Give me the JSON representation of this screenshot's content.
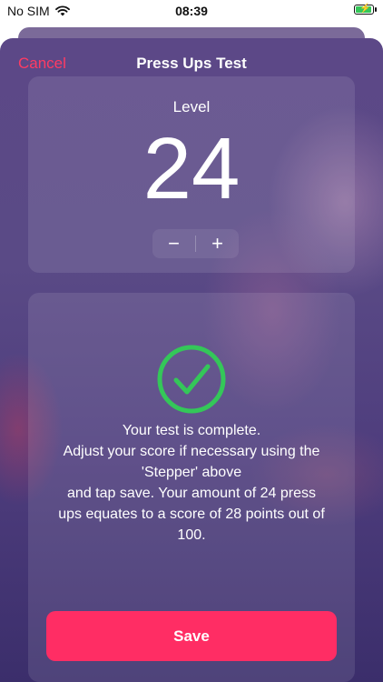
{
  "status_bar": {
    "carrier": "No SIM",
    "time": "08:39",
    "wifi_icon": "wifi-icon",
    "battery_icon": "battery-charging-icon"
  },
  "nav": {
    "cancel_label": "Cancel",
    "title": "Press Ups Test"
  },
  "level": {
    "label": "Level",
    "value": "24",
    "decrement_label": "−",
    "increment_label": "+"
  },
  "result": {
    "icon": "check-circle-icon",
    "lines": [
      "Your test is complete.",
      "Adjust your score if necessary using the",
      "'Stepper' above",
      "and tap save. Your amount of 24 press",
      "ups equates to a score of 28 points out of",
      "100."
    ],
    "save_label": "Save"
  },
  "colors": {
    "accent": "#ff2d64",
    "cancel": "#ff3b63",
    "success": "#34c759",
    "background": "#5a4a86"
  }
}
